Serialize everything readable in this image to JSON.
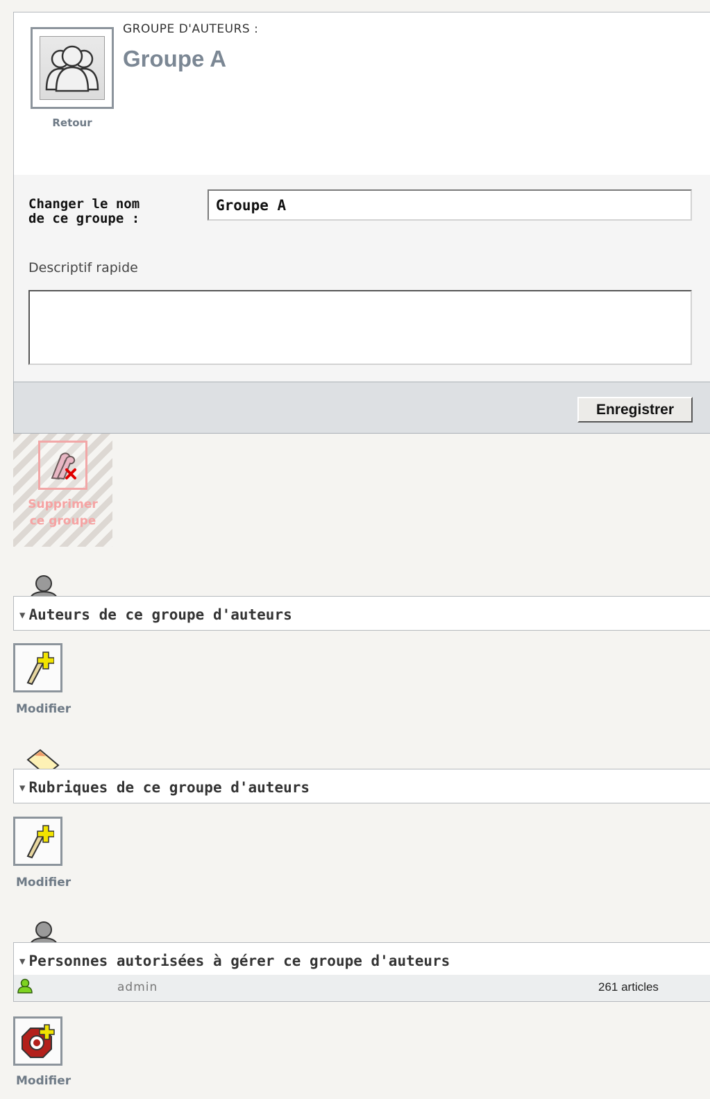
{
  "header": {
    "kicker": "GROUPE D'AUTEURS :",
    "title": "Groupe A",
    "back_label": "Retour"
  },
  "form": {
    "name_label_line1": "Changer le nom",
    "name_label_line2": "de ce groupe :",
    "name_value": "Groupe A",
    "description_label": "Descriptif rapide",
    "description_value": "",
    "save_label": "Enregistrer"
  },
  "delete": {
    "label_line1": "Supprimer",
    "label_line2": "ce groupe"
  },
  "sections": {
    "authors": {
      "title": "Auteurs de ce groupe d'auteurs",
      "modify_label": "Modifier",
      "icon": "author-icon"
    },
    "rubriques": {
      "title": "Rubriques de ce groupe d'auteurs",
      "modify_label": "Modifier",
      "icon": "folder-icon"
    },
    "managers": {
      "title": "Personnes autorisées à gérer ce groupe d'auteurs",
      "modify_label": "Modifier",
      "icon": "author-icon",
      "rows": [
        {
          "name": "admin",
          "count": "261 articles",
          "icon": "user-green-icon"
        }
      ]
    }
  },
  "colors": {
    "accent_text": "#7b8794",
    "delete_text": "#f6a3a3",
    "save_bar": "#dde0e3"
  }
}
